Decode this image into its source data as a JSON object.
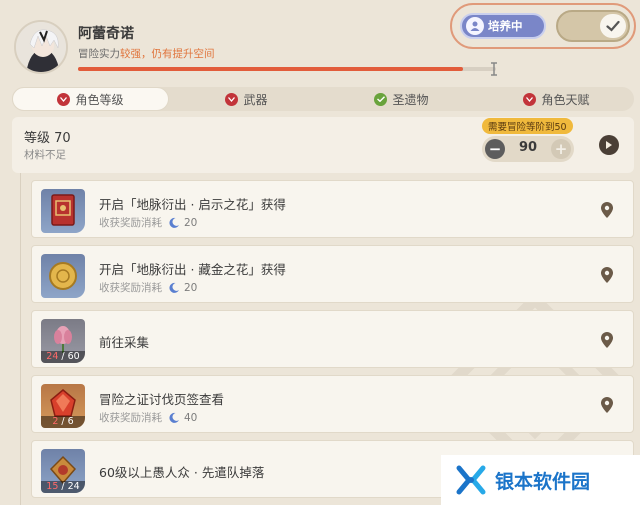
{
  "character": {
    "name": "阿蕾奇诺",
    "power_label": "冒险实力",
    "power_level": "较强",
    "power_hint": "，仍有提升空间",
    "power_progress": 0.92
  },
  "cultivate": {
    "label": "培养中",
    "toggle_on": true
  },
  "tabs": [
    {
      "label": "角色等级",
      "active": true,
      "dot": "red"
    },
    {
      "label": "武器",
      "active": false,
      "dot": "red"
    },
    {
      "label": "圣遗物",
      "active": false,
      "dot": "green"
    },
    {
      "label": "角色天赋",
      "active": false,
      "dot": "red"
    }
  ],
  "level": {
    "title": "等级 70",
    "subtitle": "材料不足",
    "requirement": "需要冒险等阶到50",
    "target": "90",
    "minus": "−",
    "plus": "+"
  },
  "items": [
    {
      "title": "开启「地脉衍出 · 启示之花」获得",
      "reward_label": "收获奖励消耗",
      "cost": "20",
      "icon": "book-icon",
      "count_cur": "",
      "count_total": ""
    },
    {
      "title": "开启「地脉衍出 · 藏金之花」获得",
      "reward_label": "收获奖励消耗",
      "cost": "20",
      "icon": "mora-icon",
      "count_cur": "",
      "count_total": ""
    },
    {
      "title": "前往采集",
      "reward_label": "",
      "cost": "",
      "icon": "flower-icon",
      "count_cur": "24",
      "count_total": " / 60"
    },
    {
      "title": "冒险之证讨伐页签查看",
      "reward_label": "收获奖励消耗",
      "cost": "40",
      "icon": "gem-icon",
      "count_cur": "2",
      "count_total": " / 6"
    },
    {
      "title": "60级以上愚人众 · 先遣队掉落",
      "reward_label": "",
      "cost": "",
      "icon": "insignia-icon",
      "count_cur": "15",
      "count_total": " / 24"
    }
  ],
  "watermark": {
    "text": "银本软件园"
  },
  "colors": {
    "accent_red": "#e25c3b",
    "tab_red": "#c2343a",
    "tab_green": "#69a33c",
    "cultivate_blue": "#7a86c8",
    "watermark_blue": "#1b74c9"
  }
}
